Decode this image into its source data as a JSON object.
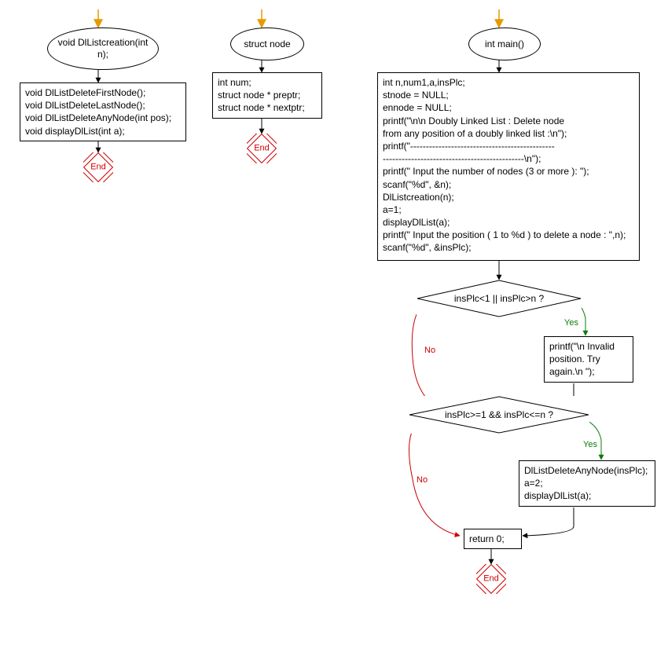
{
  "flowchart": {
    "col1": {
      "ellipse": "void DlListcreation(int\nn);",
      "box": "void DlListDeleteFirstNode();\nvoid DlListDeleteLastNode();\nvoid DlListDeleteAnyNode(int pos);\nvoid displayDlList(int a);",
      "end": "End"
    },
    "col2": {
      "ellipse": "struct node",
      "box": "int num;\nstruct node * preptr;\nstruct node * nextptr;",
      "end": "End"
    },
    "col3": {
      "ellipse": "int main()",
      "box_main": "int n,num1,a,insPlc;\nstnode = NULL;\nennode = NULL;\nprintf(\"\\n\\n Doubly Linked List : Delete node\nfrom any position of a doubly linked list :\\n\");\nprintf(\"----------------------------------------------\n---------------------------------------------\\n\");\nprintf(\" Input the number of nodes (3 or more ): \");\nscanf(\"%d\", &n);\nDlListcreation(n);\na=1;\ndisplayDlList(a);\nprintf(\" Input the position ( 1 to %d ) to delete a node : \",n);\nscanf(\"%d\", &insPlc);",
      "decision1": "insPlc<1 || insPlc>n ?",
      "invalid_box": "printf(\"\\n Invalid\n position. Try\n again.\\n \");",
      "decision2": "insPlc>=1 && insPlc<=n ?",
      "delete_box": "DlListDeleteAnyNode(insPlc);\na=2;\ndisplayDlList(a);",
      "return_box": "return 0;",
      "end": "End"
    },
    "labels": {
      "yes": "Yes",
      "no": "No"
    }
  }
}
